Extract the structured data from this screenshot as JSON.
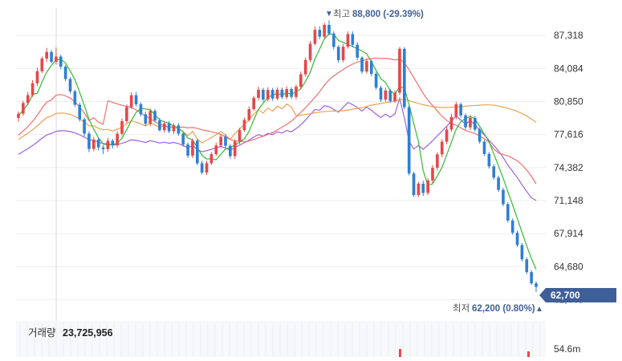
{
  "chart_data": {
    "type": "candlestick",
    "ylim": [
      60000,
      90000
    ],
    "y_ticks": [
      "87,318",
      "84,084",
      "80,850",
      "77,616",
      "74,382",
      "71,148",
      "67,914",
      "64,680",
      "61,446"
    ],
    "y_tick_values": [
      87318,
      84084,
      80850,
      77616,
      74382,
      71148,
      67914,
      64680,
      61446
    ],
    "current_price": 62700,
    "current_price_label": "62,700",
    "high": {
      "price": 88800,
      "label_prefix": "최고",
      "label_value": "88,800 (-29.39%)",
      "index": 75
    },
    "low": {
      "price": 62200,
      "label_prefix": "최저",
      "label_value": "62,200 (0.80%)",
      "index": 128
    },
    "volume_label": "거래량",
    "volume_value": "23,725,956",
    "volume_tick": "54.6m",
    "colors": {
      "up": "#e5474b",
      "down": "#2f7fd4",
      "ma5": "#33bb33",
      "ma20": "#f07070",
      "ma60": "#f0a050",
      "ma120": "#a060e0",
      "price_tag": "#3f5f99"
    },
    "candles": [
      [
        79250,
        79865,
        78850,
        79663
      ],
      [
        79663,
        80924,
        79443,
        80700
      ],
      [
        80700,
        81796,
        80483,
        81479
      ],
      [
        81479,
        82950,
        81294,
        82631
      ],
      [
        82631,
        84167,
        82349,
        83807
      ],
      [
        83807,
        85254,
        83628,
        85057
      ],
      [
        85057,
        86096,
        84719,
        85700
      ],
      [
        85700,
        85898,
        84574,
        84741
      ],
      [
        84741,
        86127,
        84479,
        85250
      ],
      [
        85250,
        85438,
        84006,
        84265
      ],
      [
        84265,
        84420,
        82848,
        83046
      ],
      [
        83046,
        83223,
        81640,
        81843
      ],
      [
        81843,
        82009,
        80320,
        80532
      ],
      [
        80532,
        80739,
        78881,
        79107
      ],
      [
        79107,
        79278,
        77434,
        77704
      ],
      [
        77704,
        77933,
        75884,
        76204
      ],
      [
        76204,
        77390,
        75966,
        77119
      ],
      [
        77119,
        77329,
        76055,
        76350
      ],
      [
        76350,
        76600,
        75700,
        76187
      ],
      [
        76187,
        77289,
        75949,
        77003
      ],
      [
        77003,
        77197,
        76238,
        76550
      ],
      [
        76550,
        77935,
        76356,
        77691
      ],
      [
        77691,
        79200,
        77520,
        78925
      ],
      [
        78925,
        80548,
        78735,
        80300
      ],
      [
        80300,
        81767,
        80128,
        81461
      ],
      [
        81461,
        81796,
        80362,
        80582
      ],
      [
        80582,
        80777,
        79410,
        79600
      ],
      [
        79600,
        79827,
        78450,
        78661
      ],
      [
        78661,
        80154,
        78425,
        79922
      ],
      [
        79922,
        80111,
        78789,
        79000
      ],
      [
        79000,
        79237,
        77903,
        78045
      ],
      [
        78045,
        78920,
        77811,
        78700
      ],
      [
        78700,
        78923,
        77761,
        77936
      ],
      [
        77936,
        78733,
        77680,
        78514
      ],
      [
        78514,
        78723,
        77500,
        77700
      ],
      [
        77700,
        77855,
        76430,
        76639
      ],
      [
        76639,
        76843,
        75318,
        75550
      ],
      [
        75550,
        77237,
        75306,
        77021
      ],
      [
        77021,
        77192,
        74600,
        74800
      ],
      [
        74800,
        75054,
        73712,
        73900
      ],
      [
        73900,
        75056,
        73649,
        74810
      ],
      [
        74810,
        75899,
        74624,
        75700
      ],
      [
        75700,
        76826,
        75517,
        76550
      ],
      [
        76550,
        77637,
        76293,
        77400
      ],
      [
        77400,
        77651,
        76267,
        76516
      ],
      [
        76516,
        76701,
        75251,
        75500
      ],
      [
        75500,
        77168,
        75240,
        76936
      ],
      [
        76936,
        78292,
        76686,
        78050
      ],
      [
        78050,
        79272,
        77875,
        79042
      ],
      [
        79042,
        80388,
        78870,
        80100
      ],
      [
        80100,
        81409,
        79926,
        81206
      ],
      [
        81206,
        82304,
        80950,
        82000
      ],
      [
        82000,
        82197,
        80833,
        81041
      ],
      [
        81041,
        82254,
        80846,
        81983
      ],
      [
        81983,
        82182,
        80917,
        81139
      ],
      [
        81139,
        82244,
        80974,
        82009
      ],
      [
        82009,
        82231,
        81073,
        81286
      ],
      [
        81286,
        82319,
        81069,
        82066
      ],
      [
        82066,
        82257,
        81094,
        81300
      ],
      [
        81300,
        82508,
        81052,
        82302
      ],
      [
        82302,
        83786,
        82050,
        83510
      ],
      [
        83510,
        85172,
        83296,
        84915
      ],
      [
        84915,
        86783,
        84684,
        86500
      ],
      [
        86500,
        88204,
        86317,
        87863
      ],
      [
        87863,
        88219,
        86944,
        87200
      ],
      [
        87200,
        88562,
        86952,
        88350
      ],
      [
        88350,
        88800,
        87300,
        87500
      ],
      [
        87500,
        87723,
        85950,
        86200
      ],
      [
        86200,
        86349,
        84632,
        84900
      ],
      [
        84900,
        86468,
        84695,
        86206
      ],
      [
        86206,
        87720,
        86025,
        87450
      ],
      [
        87450,
        87716,
        86158,
        86409
      ],
      [
        86409,
        86670,
        84900,
        85141
      ],
      [
        85141,
        85282,
        83549,
        83784
      ],
      [
        83784,
        85058,
        83594,
        84800
      ],
      [
        84800,
        84965,
        83313,
        83550
      ],
      [
        83550,
        83755,
        82006,
        82200
      ],
      [
        82200,
        82393,
        80800,
        81031
      ],
      [
        81031,
        82200,
        80836,
        81926
      ],
      [
        81926,
        82107,
        80717,
        80900
      ],
      [
        80900,
        81944,
        80721,
        81711
      ],
      [
        81711,
        86200,
        81500,
        86000
      ],
      [
        86000,
        86175,
        80100,
        80300
      ],
      [
        80300,
        80461,
        73600,
        73800
      ],
      [
        73800,
        73970,
        71500,
        71700
      ],
      [
        71700,
        73002,
        71500,
        72800
      ],
      [
        72800,
        73100,
        71600,
        71900
      ],
      [
        71900,
        73331,
        71688,
        73118
      ],
      [
        73118,
        74640,
        72872,
        74360
      ],
      [
        74360,
        75876,
        74081,
        75675
      ],
      [
        75675,
        77166,
        75391,
        76916
      ],
      [
        76916,
        78437,
        76664,
        78110
      ],
      [
        78110,
        79659,
        77898,
        79333
      ],
      [
        79333,
        80800,
        79100,
        80574
      ],
      [
        80574,
        80753,
        79257,
        79500
      ],
      [
        79500,
        79669,
        78100,
        78320
      ],
      [
        78320,
        79536,
        78073,
        79255
      ],
      [
        79255,
        79450,
        77904,
        78100
      ],
      [
        78100,
        78270,
        76732,
        76922
      ],
      [
        76922,
        77105,
        75526,
        75715
      ],
      [
        75715,
        75913,
        74281,
        74500
      ],
      [
        74500,
        74711,
        73185,
        73400
      ],
      [
        73400,
        73600,
        72000,
        72200
      ],
      [
        72200,
        72400,
        70600,
        70800
      ],
      [
        70800,
        71000,
        69000,
        69200
      ],
      [
        69200,
        69400,
        67800,
        68000
      ],
      [
        68000,
        68200,
        66600,
        66800
      ],
      [
        66800,
        67000,
        65200,
        65400
      ],
      [
        65400,
        65600,
        63950,
        64150
      ],
      [
        64150,
        64350,
        62900,
        63050
      ],
      [
        63050,
        63250,
        62200,
        62700
      ]
    ]
  }
}
